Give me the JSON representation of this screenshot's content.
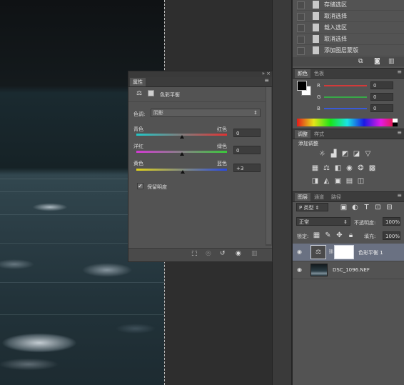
{
  "history": {
    "items": [
      {
        "label": "存储选区"
      },
      {
        "label": "取消选择"
      },
      {
        "label": "载入选区"
      },
      {
        "label": "取消选择"
      },
      {
        "label": "添加图层蒙版"
      }
    ]
  },
  "color_panel": {
    "tabs": [
      "颜色",
      "色板"
    ],
    "sliders": [
      {
        "label": "R",
        "value": "0",
        "color": "#e03a3a"
      },
      {
        "label": "G",
        "value": "0",
        "color": "#3ab04a"
      },
      {
        "label": "B",
        "value": "0",
        "color": "#3a5ae0"
      }
    ]
  },
  "adjust_panel": {
    "tabs": [
      "调整",
      "样式"
    ],
    "title": "添加调整"
  },
  "layers_panel": {
    "tabs": [
      "图层",
      "通道",
      "路径"
    ],
    "filter_kind": "P 类型",
    "blend_mode": "正常",
    "opacity_label": "不透明度:",
    "opacity_value": "100%",
    "lock_label": "锁定:",
    "fill_label": "填充:",
    "fill_value": "100%",
    "layers": [
      {
        "name": "色彩平衡 1",
        "selected": true
      },
      {
        "name": "DSC_1096.NEF",
        "selected": false
      }
    ]
  },
  "properties": {
    "tab": "属性",
    "title": "色彩平衡",
    "tone_label": "色调:",
    "tone_value": "阴影",
    "sliders": [
      {
        "left": "青色",
        "right": "红色",
        "value": "0",
        "position": 0.5
      },
      {
        "left": "洋红",
        "right": "绿色",
        "value": "0",
        "position": 0.5
      },
      {
        "left": "黄色",
        "right": "蓝色",
        "value": "+3",
        "position": 0.515
      }
    ],
    "preserve_label": "保留明度",
    "preserve_checked": true
  }
}
